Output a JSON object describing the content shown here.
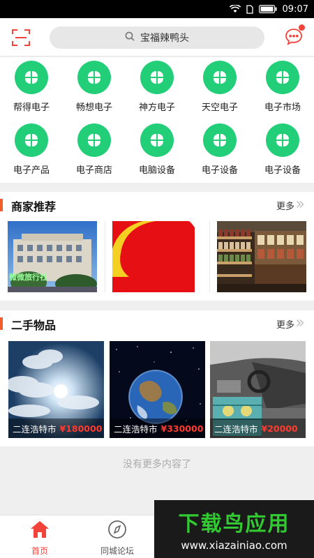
{
  "status_bar": {
    "time": "09:07"
  },
  "header": {
    "search_text": "宝福辣鸭头"
  },
  "categories": [
    {
      "label": "帮得电子"
    },
    {
      "label": "畅想电子"
    },
    {
      "label": "神方电子"
    },
    {
      "label": "天空电子"
    },
    {
      "label": "电子市场"
    },
    {
      "label": "电子产品"
    },
    {
      "label": "电子商店"
    },
    {
      "label": "电脑设备"
    },
    {
      "label": "电子设备"
    },
    {
      "label": "电子设备"
    }
  ],
  "merchants": {
    "title": "商家推荐",
    "more": "更多",
    "first_sign": "微微旅行社"
  },
  "secondhand": {
    "title": "二手物品",
    "more": "更多",
    "items": [
      {
        "name": "二连浩特市",
        "price": "¥180000"
      },
      {
        "name": "二连浩特市",
        "price": "¥330000"
      },
      {
        "name": "二连浩特市",
        "price": "¥20000"
      }
    ]
  },
  "no_more": "没有更多内容了",
  "bottom_nav": [
    {
      "label": "首页"
    },
    {
      "label": "同城论坛"
    }
  ],
  "watermark": {
    "logo": "下载鸟应用",
    "url": "www.xiazainiao.com"
  },
  "colors": {
    "accent": "#f2433a",
    "category_green": "#22cf78",
    "section_bar": "#f25b2a"
  }
}
